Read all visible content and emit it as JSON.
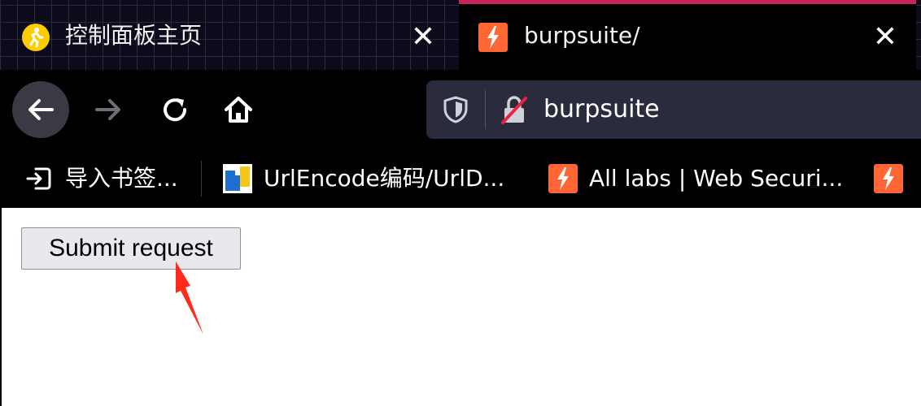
{
  "tabs": [
    {
      "title": "控制面板主页",
      "icon": "runner-icon",
      "active": false
    },
    {
      "title": "burpsuite/",
      "icon": "burp-bolt-icon",
      "active": true
    }
  ],
  "toolbar": {
    "url": "burpsuite"
  },
  "bookmarks": [
    {
      "label": "导入书签...",
      "icon": "import-icon"
    },
    {
      "label": "UrlEncode编码/UrlD...",
      "icon": "urlencode-icon"
    },
    {
      "label": "All labs | Web Securi...",
      "icon": "burp-bolt-icon"
    },
    {
      "label": "",
      "icon": "burp-bolt-icon"
    }
  ],
  "page": {
    "submit_label": "Submit request"
  },
  "colors": {
    "tab_accent": "#c8245a",
    "burp_orange": "#ff6633",
    "annotation_arrow": "#ff2a1a"
  }
}
